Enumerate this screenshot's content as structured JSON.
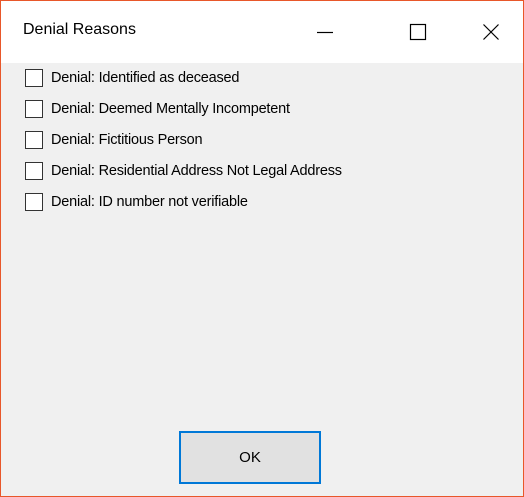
{
  "window": {
    "title": "Denial Reasons"
  },
  "caption_buttons": {
    "minimize_icon": "minimize-icon",
    "maximize_icon": "maximize-icon",
    "close_icon": "close-icon"
  },
  "checkboxes": [
    {
      "label": "Denial: Identified as deceased",
      "checked": false
    },
    {
      "label": "Denial: Deemed Mentally Incompetent",
      "checked": false
    },
    {
      "label": "Denial: Fictitious Person",
      "checked": false
    },
    {
      "label": "Denial: Residential Address Not Legal Address",
      "checked": false
    },
    {
      "label": "Denial: ID number not verifiable",
      "checked": false
    }
  ],
  "ok_button": {
    "label": "OK"
  },
  "colors": {
    "window_border": "#e8572a",
    "focus_border": "#0078d7",
    "client_background": "#f0f0f0"
  }
}
